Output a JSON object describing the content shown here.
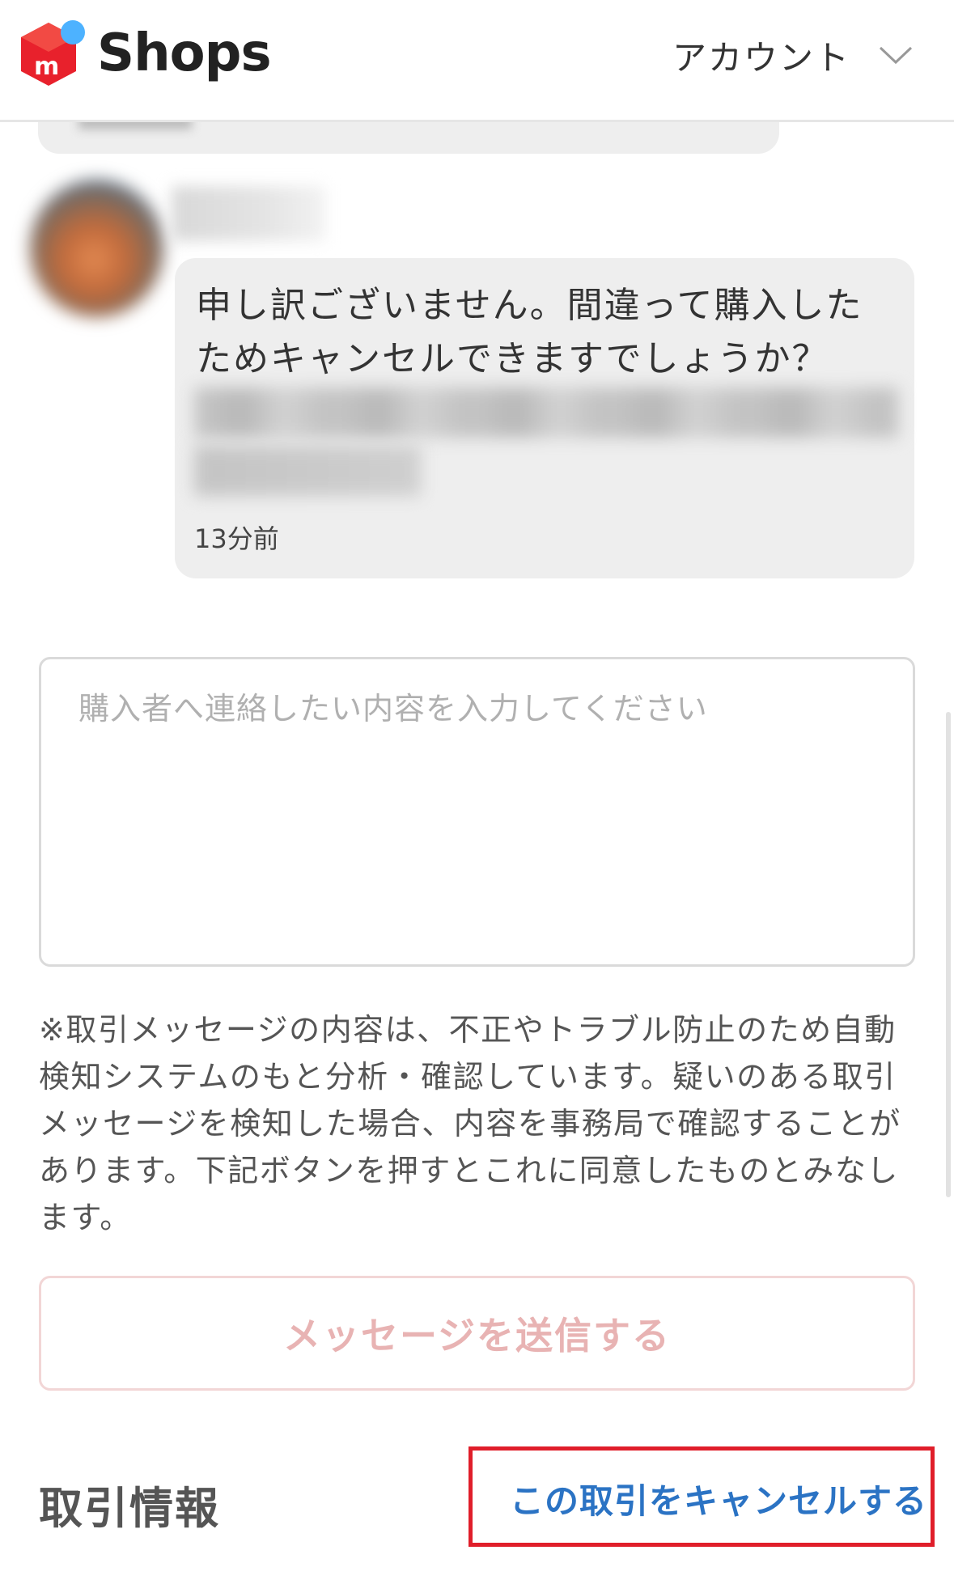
{
  "header": {
    "brand": "Shops",
    "account_label": "アカウント"
  },
  "message": {
    "text": "申し訳ございません。間違って購入したためキャンセルできますでしょうか？",
    "time": "13分前"
  },
  "composer": {
    "placeholder": "購入者へ連絡したい内容を入力してください",
    "value": ""
  },
  "notice": "※取引メッセージの内容は、不正やトラブル防止のため自動検知システムのもと分析・確認しています。疑いのある取引メッセージを検知した場合、内容を事務局で確認することがあります。下記ボタンを押すとこれに同意したものとみなします。",
  "send_button_label": "メッセージを送信する",
  "transaction": {
    "section_title": "取引情報",
    "cancel_label": "この取引をキャンセルする"
  },
  "colors": {
    "brand_red": "#e8212c",
    "brand_blue_dot": "#4db2ff",
    "link_blue": "#2b73c4",
    "send_disabled": "#e8b3b3",
    "highlight_red": "#e01e2a"
  }
}
